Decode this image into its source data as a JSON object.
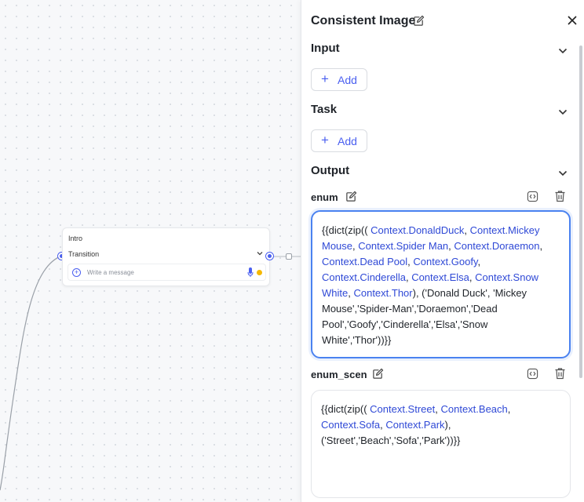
{
  "canvas": {
    "node": {
      "title": "Intro",
      "transition_label": "Transition",
      "message_placeholder": "Write a message"
    }
  },
  "panel": {
    "title": "Consistent Image",
    "sections": {
      "input": {
        "label": "Input",
        "add_label": "Add"
      },
      "task": {
        "label": "Task",
        "add_label": "Add"
      },
      "output": {
        "label": "Output"
      }
    },
    "outputs": [
      {
        "name": "enum",
        "expression": [
          {
            "t": "{{dict(zip(( "
          },
          {
            "t": "Context.DonaldDuck",
            "ctx": true
          },
          {
            "t": ", "
          },
          {
            "t": "Context.Mickey Mouse",
            "ctx": true
          },
          {
            "t": ", "
          },
          {
            "t": "Context.Spider Man",
            "ctx": true
          },
          {
            "t": ", "
          },
          {
            "t": "Context.Doraemon",
            "ctx": true
          },
          {
            "t": ", "
          },
          {
            "t": "Context.Dead Pool",
            "ctx": true
          },
          {
            "t": ", "
          },
          {
            "t": "Context.Goofy",
            "ctx": true
          },
          {
            "t": ", "
          },
          {
            "t": "Context.Cinderella",
            "ctx": true
          },
          {
            "t": ", "
          },
          {
            "t": "Context.Elsa",
            "ctx": true
          },
          {
            "t": ", "
          },
          {
            "t": "Context.Snow White",
            "ctx": true
          },
          {
            "t": ", "
          },
          {
            "t": "Context.Thor",
            "ctx": true
          },
          {
            "t": "), ('Donald Duck', 'Mickey Mouse','Spider-Man','Doraemon','Dead Pool','Goofy','Cinderella','Elsa','Snow White','Thor'))}}"
          }
        ]
      },
      {
        "name": "enum_scen",
        "expression": [
          {
            "t": "{{dict(zip(( "
          },
          {
            "t": "Context.Street",
            "ctx": true
          },
          {
            "t": ", "
          },
          {
            "t": "Context.Beach",
            "ctx": true
          },
          {
            "t": ", "
          },
          {
            "t": "Context.Sofa",
            "ctx": true
          },
          {
            "t": ", "
          },
          {
            "t": "Context.Park",
            "ctx": true
          },
          {
            "t": "), ('Street','Beach','Sofa','Park'))}}"
          }
        ]
      }
    ],
    "colors": {
      "accent": "#4a5ff0",
      "context_token": "#2f49d6",
      "active_border": "#4a82f0",
      "status_dot": "#f5b800"
    },
    "icons": [
      "edit-icon",
      "close-icon",
      "chevron-down-icon",
      "plus-icon",
      "code-icon",
      "trash-icon",
      "mic-icon"
    ]
  }
}
